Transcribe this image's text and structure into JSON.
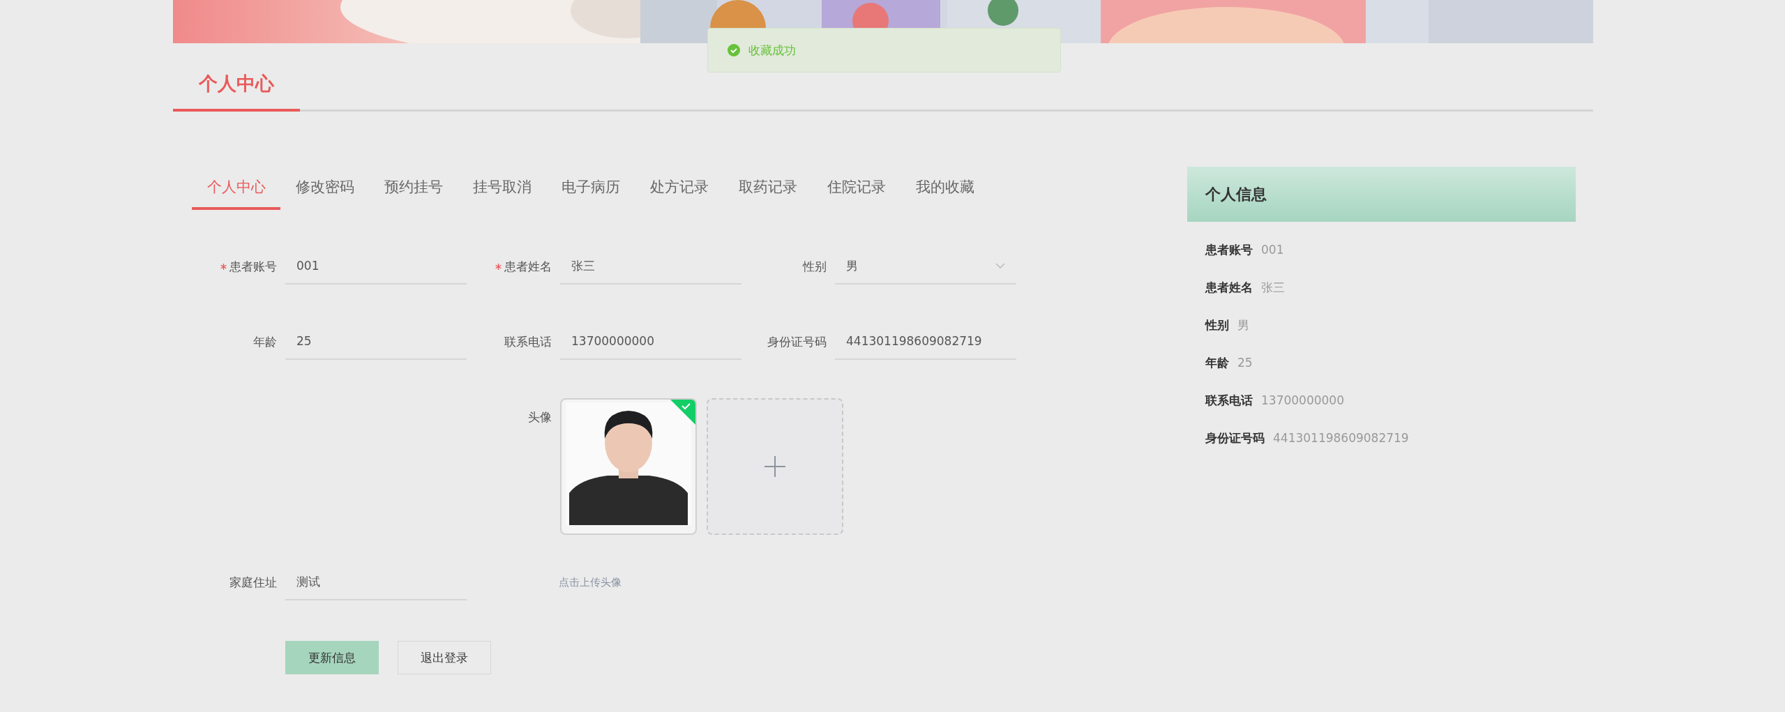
{
  "toast": {
    "text": "收藏成功"
  },
  "page_title": "个人中心",
  "tabs": [
    {
      "label": "个人中心",
      "selected": true
    },
    {
      "label": "修改密码",
      "selected": false
    },
    {
      "label": "预约挂号",
      "selected": false
    },
    {
      "label": "挂号取消",
      "selected": false
    },
    {
      "label": "电子病历",
      "selected": false
    },
    {
      "label": "处方记录",
      "selected": false
    },
    {
      "label": "取药记录",
      "selected": false
    },
    {
      "label": "住院记录",
      "selected": false
    },
    {
      "label": "我的收藏",
      "selected": false
    }
  ],
  "fields": [
    {
      "kind": "input",
      "label": "患者账号",
      "value": "001",
      "required": true
    },
    {
      "kind": "input",
      "label": "患者姓名",
      "value": "张三",
      "required": true
    },
    {
      "kind": "select",
      "label": "性别",
      "value": "男",
      "required": false
    },
    {
      "kind": "input",
      "label": "年龄",
      "value": "25",
      "required": false
    },
    {
      "kind": "input",
      "label": "联系电话",
      "value": "13700000000",
      "required": false
    },
    {
      "kind": "input",
      "label": "身份证号码",
      "value": "441301198609082719",
      "required": false
    }
  ],
  "avatar": {
    "label": "头像",
    "uploaded": true,
    "hint": "点击上传头像"
  },
  "address": {
    "label": "家庭住址",
    "value": "测试"
  },
  "buttons": [
    {
      "label": "更新信息",
      "kind": "primary"
    },
    {
      "label": "退出登录",
      "kind": "plain"
    }
  ],
  "info_panel": {
    "title": "个人信息",
    "items": [
      {
        "label": "患者账号",
        "value": "001"
      },
      {
        "label": "患者姓名",
        "value": "张三"
      },
      {
        "label": "性别",
        "value": "男"
      },
      {
        "label": "年龄",
        "value": "25"
      },
      {
        "label": "联系电话",
        "value": "13700000000"
      },
      {
        "label": "身份证号码",
        "value": "441301198609082719"
      }
    ]
  }
}
